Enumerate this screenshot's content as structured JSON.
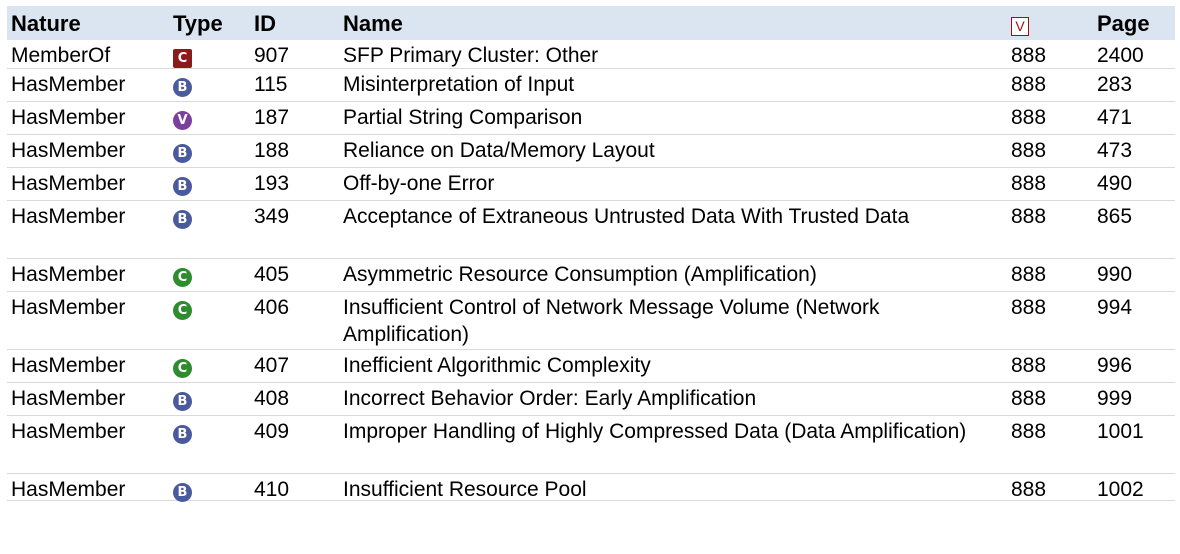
{
  "header": {
    "nature": "Nature",
    "type": "Type",
    "id": "ID",
    "name": "Name",
    "view_icon": "V",
    "page": "Page"
  },
  "colors": {
    "header_bg": "#dbe5f1",
    "category": "#8b1a1a",
    "base": "#4a5a9c",
    "variant": "#7b3f9c",
    "class": "#2e8b2e",
    "view_icon": "#a01010"
  },
  "rows": [
    {
      "nature": "MemberOf",
      "type": "C",
      "type_kind": "category",
      "id": "907",
      "name": "SFP Primary Cluster: Other",
      "view": "888",
      "page": "2400"
    },
    {
      "nature": "HasMember",
      "type": "B",
      "type_kind": "base",
      "id": "115",
      "name": "Misinterpretation of Input",
      "view": "888",
      "page": "283"
    },
    {
      "nature": "HasMember",
      "type": "V",
      "type_kind": "variant",
      "id": "187",
      "name": "Partial String Comparison",
      "view": "888",
      "page": "471"
    },
    {
      "nature": "HasMember",
      "type": "B",
      "type_kind": "base",
      "id": "188",
      "name": "Reliance on Data/Memory Layout",
      "view": "888",
      "page": "473"
    },
    {
      "nature": "HasMember",
      "type": "B",
      "type_kind": "base",
      "id": "193",
      "name": "Off-by-one Error",
      "view": "888",
      "page": "490"
    },
    {
      "nature": "HasMember",
      "type": "B",
      "type_kind": "base",
      "id": "349",
      "name": "Acceptance of Extraneous Untrusted Data With Trusted Data",
      "view": "888",
      "page": "865"
    },
    {
      "nature": "HasMember",
      "type": "C",
      "type_kind": "class",
      "id": "405",
      "name": "Asymmetric Resource Consumption (Amplification)",
      "view": "888",
      "page": "990"
    },
    {
      "nature": "HasMember",
      "type": "C",
      "type_kind": "class",
      "id": "406",
      "name": "Insufficient Control of Network Message Volume (Network Amplification)",
      "view": "888",
      "page": "994"
    },
    {
      "nature": "HasMember",
      "type": "C",
      "type_kind": "class",
      "id": "407",
      "name": "Inefficient Algorithmic Complexity",
      "view": "888",
      "page": "996"
    },
    {
      "nature": "HasMember",
      "type": "B",
      "type_kind": "base",
      "id": "408",
      "name": "Incorrect Behavior Order: Early Amplification",
      "view": "888",
      "page": "999"
    },
    {
      "nature": "HasMember",
      "type": "B",
      "type_kind": "base",
      "id": "409",
      "name": "Improper Handling of Highly Compressed Data (Data Amplification)",
      "view": "888",
      "page": "1001"
    },
    {
      "nature": "HasMember",
      "type": "B",
      "type_kind": "base",
      "id": "410",
      "name": "Insufficient Resource Pool",
      "view": "888",
      "page": "1002"
    }
  ]
}
